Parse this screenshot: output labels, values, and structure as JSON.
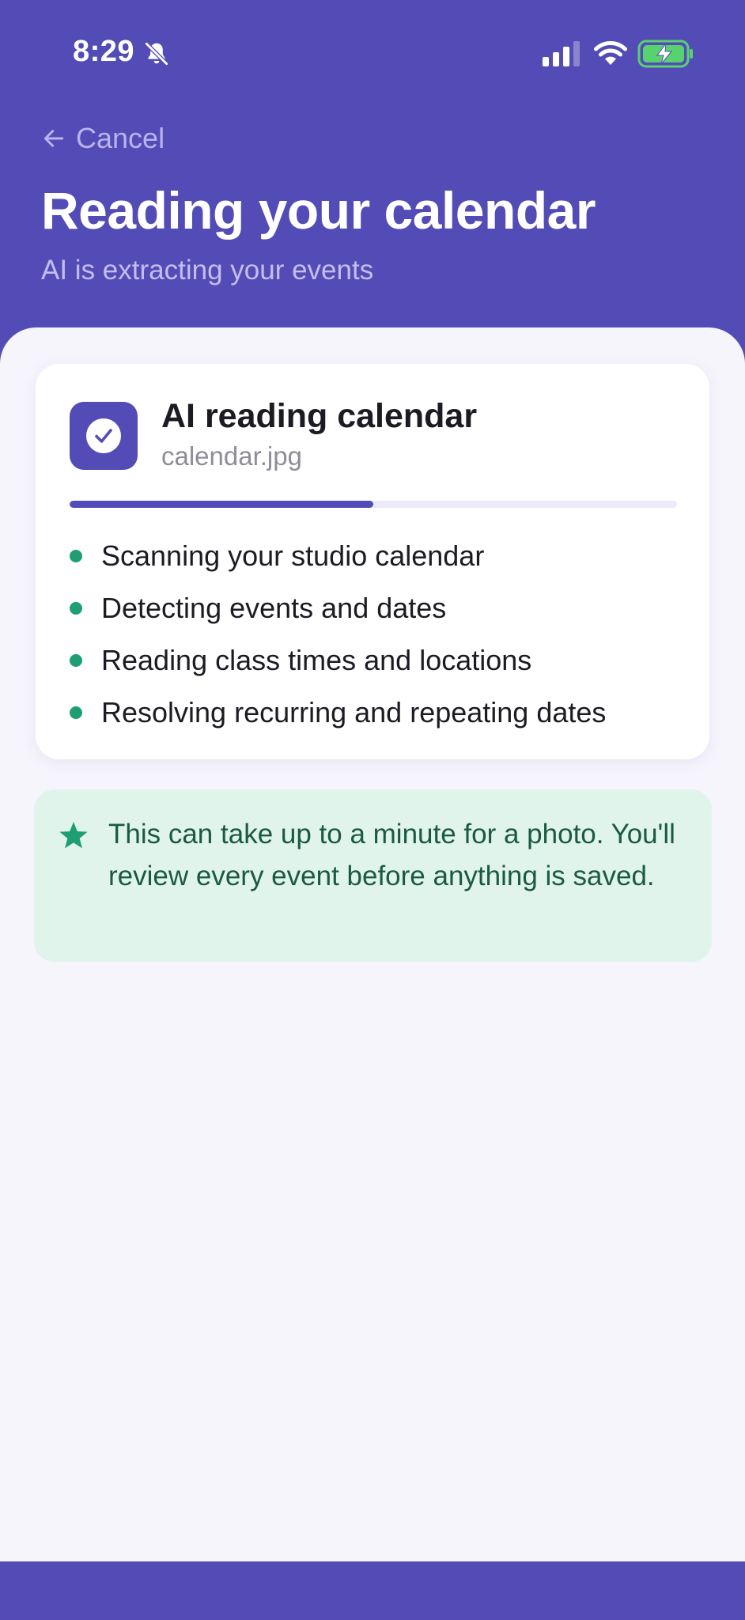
{
  "status_bar": {
    "time": "8:29",
    "icons": [
      "bell-slash-icon",
      "signal-icon",
      "wifi-icon",
      "battery-charging-icon"
    ]
  },
  "header": {
    "cancel_label": "Cancel",
    "title": "Reading your calendar",
    "subtitle": "AI is extracting your events"
  },
  "card": {
    "title": "AI reading calendar",
    "file_name": "calendar.jpg",
    "icon": "check-circle-icon",
    "progress": 0.5,
    "steps": [
      "Scanning your studio calendar",
      "Detecting events and dates",
      "Reading class times and locations",
      "Resolving recurring and repeating dates"
    ]
  },
  "notice": {
    "icon": "star-icon",
    "text": "This can take up to a minute for a photo. You'll review every event before anything is saved."
  },
  "colors": {
    "brand": "#544cb6",
    "accent_green": "#1e9e72",
    "notice_bg": "#e1f4ec",
    "notice_text": "#1a5a43",
    "background": "#f6f5fc"
  }
}
